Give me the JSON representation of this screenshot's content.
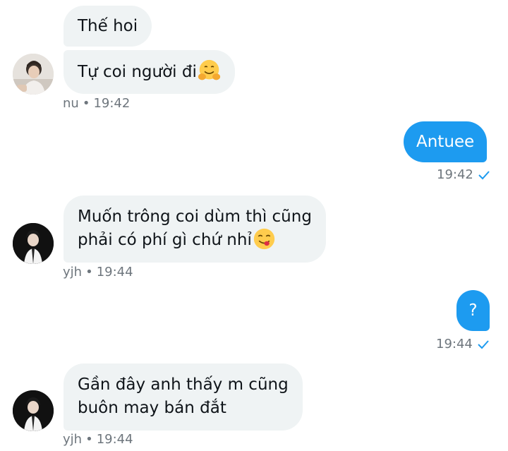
{
  "messages": [
    {
      "sender": "nu",
      "text": "Thế hoi"
    },
    {
      "sender": "nu",
      "text": "Tự coi người đi",
      "emoji": "hugging-face-emoji"
    },
    {
      "meta": {
        "name": "nu",
        "sep": "•",
        "time": "19:42"
      }
    },
    {
      "sender": "me",
      "text": "Antuee",
      "time": "19:42",
      "status": "sent-check-icon"
    },
    {
      "sender": "yjh",
      "lines": [
        "Muốn trông coi dùm thì cũng",
        "phải có phí gì chứ nhỉ"
      ],
      "emoji": "savoring-food-emoji"
    },
    {
      "meta": {
        "name": "yjh",
        "sep": "•",
        "time": "19:44"
      }
    },
    {
      "sender": "me",
      "text": "?",
      "time": "19:44",
      "status": "sent-check-icon"
    },
    {
      "sender": "yjh",
      "lines": [
        "Gần đây anh thấy m cũng",
        "buôn may bán đắt"
      ]
    },
    {
      "meta": {
        "name": "yjh",
        "sep": "•",
        "time": "19:44"
      }
    }
  ],
  "colors": {
    "incoming_bubble": "#eff3f4",
    "outgoing_bubble": "#1d9bf0",
    "meta_text": "#6e767d",
    "check": "#1d9bf0"
  }
}
